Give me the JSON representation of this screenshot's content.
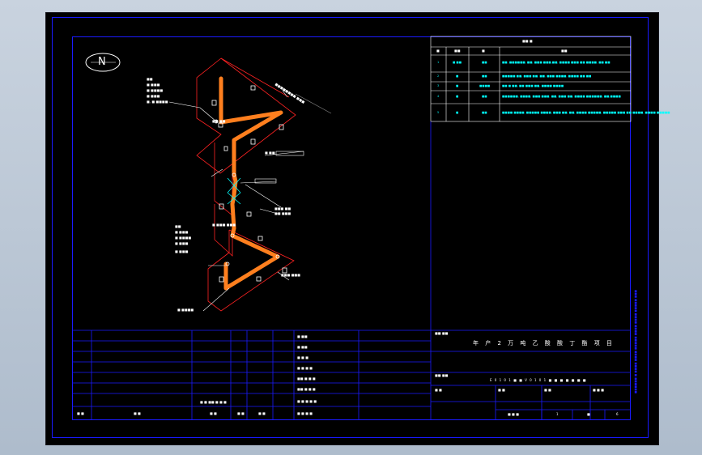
{
  "colors": {
    "frame": "#1a1aff",
    "pipe": "#ff7f1e",
    "boundary": "#ff2222",
    "text": "#ffffff",
    "table_text": "#00ffff"
  },
  "north": {
    "label": "N"
  },
  "material_table": {
    "title": "■■ ■",
    "headers": [
      "■",
      "■■",
      "■",
      "■■"
    ],
    "rows": [
      {
        "no": "1",
        "spec": "■ ■■",
        "qty": "■■",
        "note": "■■, ■■■■■■, ■■, ■■■ ■■■,■■, ■■■■ ■■■ ■■ ■■■■, ■■ ■■"
      },
      {
        "no": "2",
        "spec": "■",
        "qty": "■■",
        "note": "■■■■■ ■■, ■■■ ■■, ■■, ■■■ ■■■■, ■■■■ ■■ ■■"
      },
      {
        "no": "3",
        "spec": "■",
        "qty": "■■■■",
        "note": "■■ ■ ■■, ■■ ■■■ ■■, ■■■■ ■■■■"
      },
      {
        "no": "4",
        "spec": "■",
        "qty": "■■",
        "note": "■■■■■■, ■■■■, ■■■ ■■■, ■■, ■■■ ■■, ■■■■ ■■■■■■, ■■,■■■■"
      },
      {
        "no": "5",
        "spec": "■",
        "qty": "■■",
        "note": "■■■■ ■■■■, ■■■■■ ■■■■, ■■■ ■■, ■■, ■■■■ ■■■■■, ■■■■■ ■■■ ■■ ■■■■, ■■■■ ■■■■■"
      }
    ]
  },
  "callouts": {
    "upper_left": [
      "■■",
      "■ ■■■",
      "■ ■■■■",
      "■ ■■■",
      "■, ■ ■■■■"
    ],
    "lower_left": [
      "■■",
      "■ ■■■",
      "■ ■■■■",
      "■ ■■■",
      "■ ■■■"
    ],
    "labels": [
      "■■■■■■■■ ■■■",
      "■ ■■",
      "■ ■■■ ■■■",
      "■■■ ■■",
      "■■ ■■■",
      "■■ ■■",
      "■■■ ■■■",
      "■ ■■■■"
    ]
  },
  "title_block": {
    "left_signatures": [
      "■ ■■",
      "■ ■■",
      "■ ■ ■",
      "■ ■ ■ ■",
      "■■ ■ ■ ■",
      "■■ ■ ■ ■",
      "■ ■ ■ ■ ■"
    ],
    "bottom_row": [
      "■ ■",
      "■ ■",
      "■ ■",
      "■ ■",
      "■ ■",
      "■ ■ ■ ■"
    ],
    "scale_note": "■ ■ ■■ ■ ■ ■",
    "project_label": "■■ ■■",
    "project_name": "年 产 2 万 吨 乙 酸 酸 丁 酯 项 目",
    "drawing_label": "■■ ■■",
    "drawing_name": "E 0 1 0 1 ■ ■ V 0 1 0 1 ■ ■ ■ ■ ■ ■ ■",
    "fields": [
      "■ ■",
      "■ ■",
      "■ ■",
      "■ ■ ■"
    ],
    "sheet_no": [
      "■ ■ ■",
      "1",
      "■",
      "6"
    ]
  },
  "side_strip": "■■■■■■ ■ ■■■■ ■■■■ ■■■■■ ■■■■ ■■■■ ■■■■■ ■■■"
}
